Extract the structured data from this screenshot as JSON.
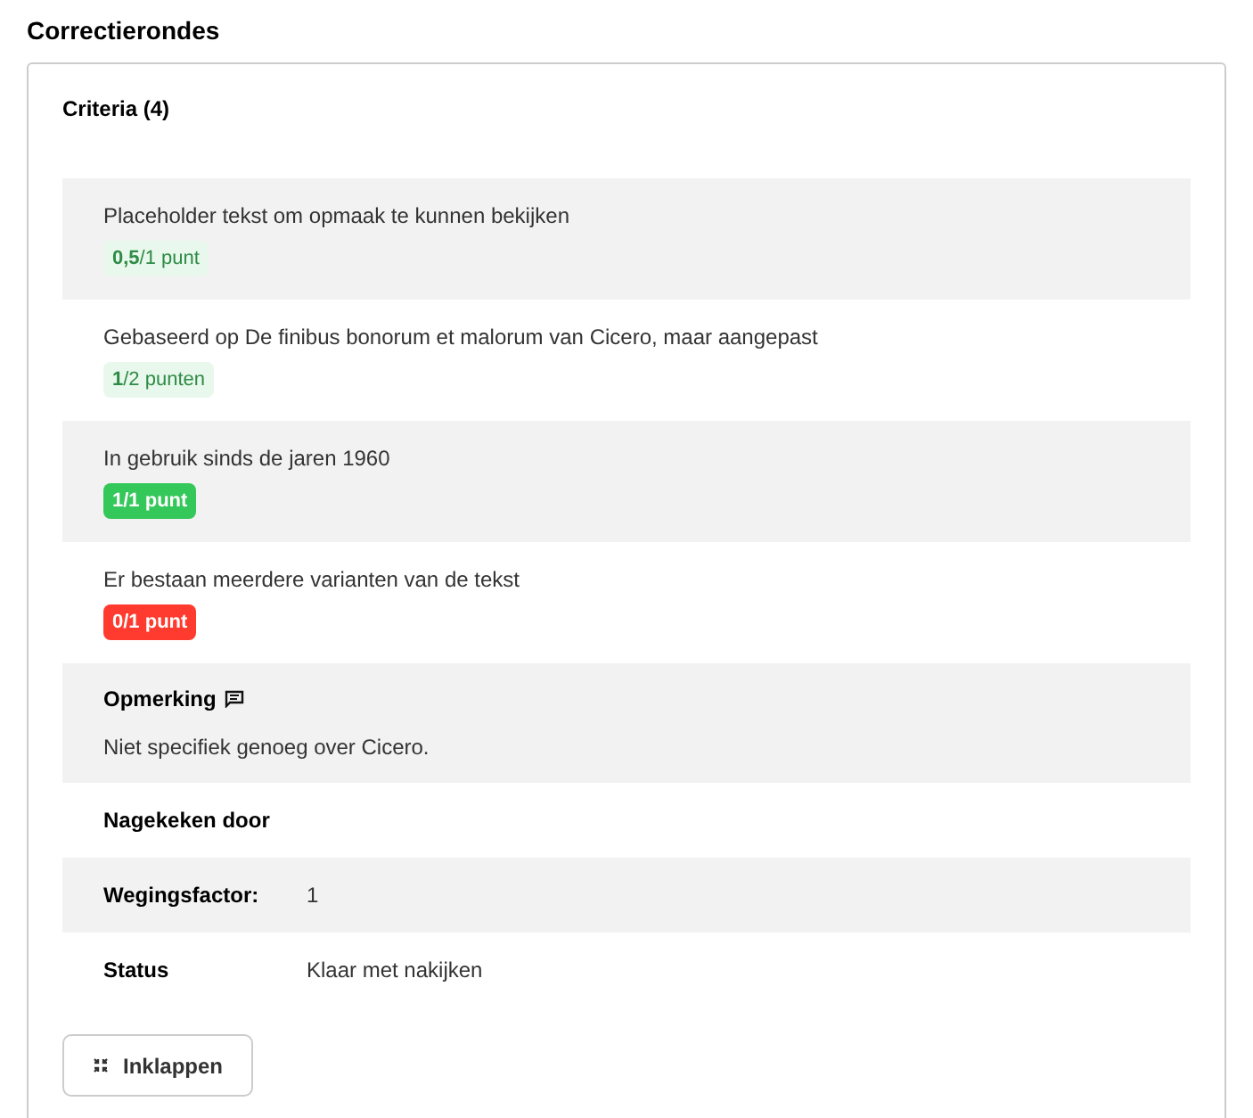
{
  "title": "Correctierondes",
  "criteria": {
    "heading": "Criteria (4)",
    "items": [
      {
        "text": "Placeholder tekst om opmaak te kunnen bekijken",
        "score": "**0,5**/1 punt",
        "kind": "partial"
      },
      {
        "text": "Gebaseerd op De finibus bonorum et malorum van Cicero, maar aangepast",
        "score": "**1**/2 punten",
        "kind": "partial"
      },
      {
        "text": "In gebruik sinds de jaren 1960",
        "score": "1/1 punt",
        "kind": "full"
      },
      {
        "text": "Er bestaan meerdere varianten van de tekst",
        "score": "0/1 punt",
        "kind": "none"
      }
    ]
  },
  "remark": {
    "label": "Opmerking",
    "text": "Niet specifiek genoeg over Cicero."
  },
  "details": [
    {
      "label": "Nagekeken door"
    },
    {
      "label": "Wegingsfactor:",
      "value": "1"
    },
    {
      "label": "Status",
      "value": "Klaar met nakijken"
    }
  ],
  "collapse_button": "Inklappen"
}
